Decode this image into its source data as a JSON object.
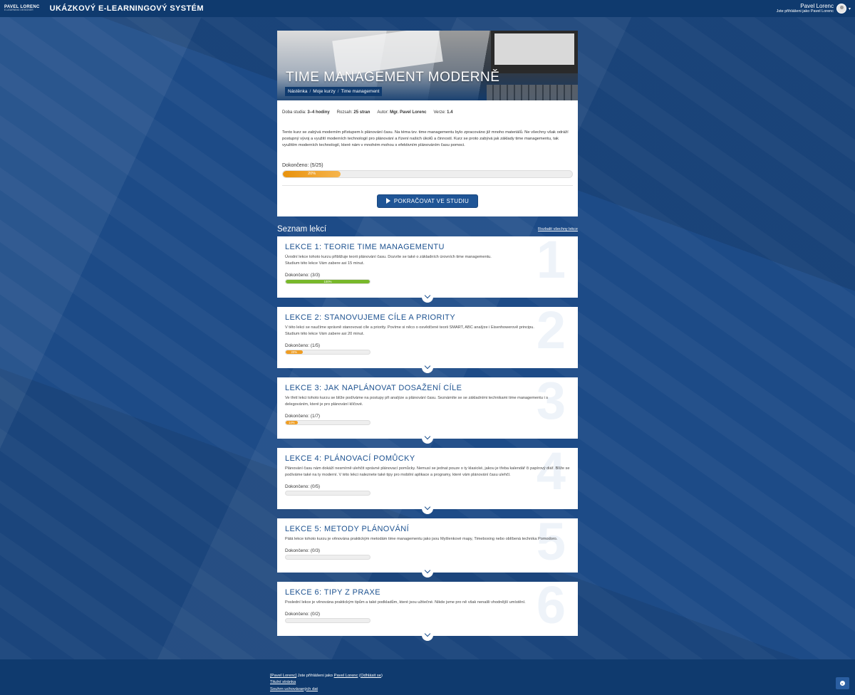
{
  "header": {
    "logo_line1": "PAVEL LORENC",
    "logo_line2": "E-LEARNING DESIGNER",
    "site_name": "UKÁZKOVÝ E-LEARNINGOVÝ SYSTÉM",
    "user_name": "Pavel Lorenc",
    "user_info": "Jste přihlášeni jako Pavel Lorenc"
  },
  "course": {
    "title": "TIME MANAGEMENT MODERNĚ",
    "breadcrumb": [
      "Nástěnka",
      "Moje kurzy",
      "Time management"
    ],
    "study_label": "Doba studia:",
    "study_value": "3–4 hodiny",
    "range_label": "Rozsah:",
    "range_value": "25 stran",
    "author_label": "Autor:",
    "author_value": "Mgr. Pavel Lorenc",
    "version_label": "Verze:",
    "version_value": "1.4",
    "description": "Tento kurz se zabývá moderním přístupem k plánování času. Na téma tzv. time managementu bylo zpracováno již mnoho materiálů. Ne všechny však odráží postupný vývoj a využití moderních technologií pro plánování a řízení našich úkolů a činností. Kurz se proto zabývá jak základy time managementu, tak využitím moderních technologií, které nám v mnohém mohou s efektivním plánováním času pomoci.",
    "completed_label": "Dokončeno: (5/25)",
    "progress_percent": 20,
    "progress_text": "20%",
    "cta_label": "POKRAČOVAT VE STUDIU"
  },
  "lessons_section": {
    "title": "Seznam lekcí",
    "expand_all": "Rozbalit všechny lekce"
  },
  "lessons": [
    {
      "number": "1",
      "title": "LEKCE 1: TEORIE TIME MANAGEMENTU",
      "desc": "Úvodní lekce tohoto kurzu přibližuje teorii plánování času. Dozvíte se také o základních úrovních time managementu.",
      "desc2": "Studium této lekce Vám zabere asi 15 minut.",
      "completed": "Dokončeno: (3/3)",
      "percent": 100,
      "percent_text": "100%",
      "color": "green"
    },
    {
      "number": "2",
      "title": "LEKCE 2: STANOVUJEME CÍLE A PRIORITY",
      "desc": "V této lekci se naučíme správně stanovovat cíle a priority. Povíme si něco o osvědčené teorii SMART, ABC analýze i Eisenhowerově principu.",
      "desc2": "Studium této lekce Vám zabere asi 20 minut.",
      "completed": "Dokončeno: (1/5)",
      "percent": 20,
      "percent_text": "20%",
      "color": "orange"
    },
    {
      "number": "3",
      "title": "LEKCE 3: JAK NAPLÁNOVAT DOSAŽENÍ CÍLE",
      "desc": "Ve třetí lekci tohoto kurzu se blíže podíváme na postupy při analýze a plánování času. Seznámíte se se základními technikami time managementu i s delegováním, které je pro plánování klíčové.",
      "desc2": "",
      "completed": "Dokončeno: (1/7)",
      "percent": 14,
      "percent_text": "14%",
      "color": "orange"
    },
    {
      "number": "4",
      "title": "LEKCE 4: PLÁNOVACÍ POMŮCKY",
      "desc": "Plánování času nám dokáží nesmírně ulehčit správné plánovací pomůcky. Nemusí se jednat pouze o ty klasické, jakou je třeba kalendář či papírový diář. Blíže se podíváme také na ty moderní. V této lekci naleznete také tipy pro mobilní aplikace a programy, které vám plánování času ulehčí.",
      "desc2": "",
      "completed": "Dokončeno: (0/5)",
      "percent": 0,
      "percent_text": "",
      "color": "orange"
    },
    {
      "number": "5",
      "title": "LEKCE 5: METODY PLÁNOVÁNÍ",
      "desc": "Pátá lekce tohoto kurzu je věnována praktickým metodám time managementu jako jsou Myšlenkové mapy, Timeboxing nebo oblíbená technika Pomodoro.",
      "desc2": "",
      "completed": "Dokončeno: (0/3)",
      "percent": 0,
      "percent_text": "",
      "color": "orange"
    },
    {
      "number": "6",
      "title": "LEKCE 6: TIPY Z PRAXE",
      "desc": "Poslední lekce je věnována praktickým tipům a také podkladům, které jsou užitečné. Nikde jsme pro ně však nenašli vhodnější umístění.",
      "desc2": "",
      "completed": "Dokončeno: (0/2)",
      "percent": 0,
      "percent_text": "",
      "color": "orange"
    }
  ],
  "footer": {
    "user_link": "[Pavel Lorenc]",
    "logged_text": " Jste přihlášeni jako ",
    "name_link": "Pavel Lorenc",
    "logout_open": " (",
    "logout": "Odhlásit se",
    "logout_close": ")",
    "home": "Titulní stránka",
    "retention": "Souhrn uchovávaných dat"
  },
  "icons": {
    "play": "play-icon",
    "chevron": "chevron-down-icon",
    "to_top": "arrow-up-circle-icon",
    "caret": "caret-down-icon"
  }
}
